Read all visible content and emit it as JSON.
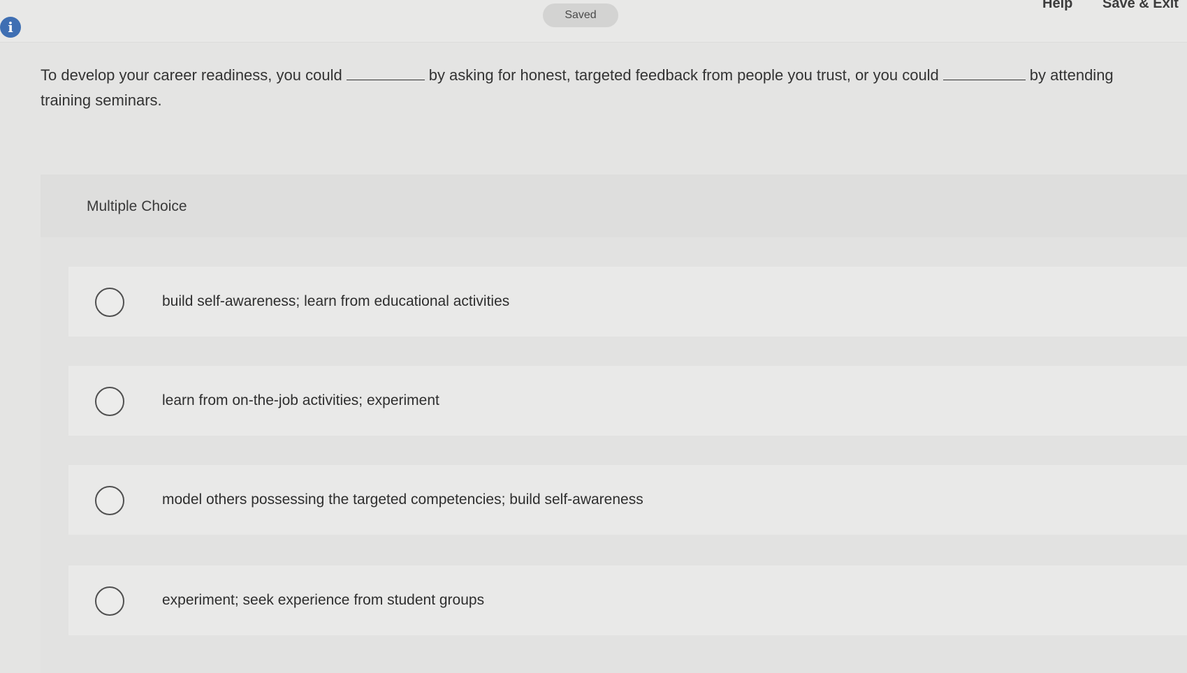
{
  "header": {
    "info_icon": "info-icon",
    "status": "Saved",
    "help_label": "Help",
    "save_exit_label": "Save & Exit"
  },
  "question": {
    "part1": "To develop your career readiness, you could",
    "part2": "by asking for honest, targeted feedback from people you trust, or you could",
    "part3": "by attending training seminars."
  },
  "multiple_choice": {
    "label": "Multiple Choice",
    "options": [
      {
        "label": "build self-awareness; learn from educational activities",
        "selected": false
      },
      {
        "label": "learn from on-the-job activities; experiment",
        "selected": false
      },
      {
        "label": "model others possessing the targeted competencies; build self-awareness",
        "selected": false
      },
      {
        "label": "experiment; seek experience from student groups",
        "selected": false
      }
    ]
  }
}
